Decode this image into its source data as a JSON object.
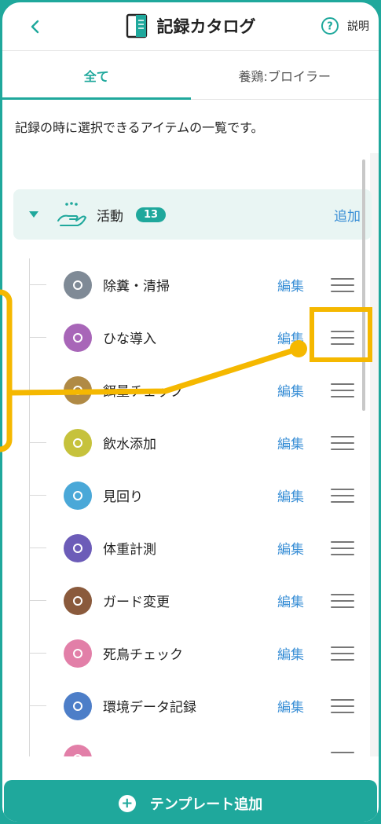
{
  "header": {
    "back_label": "<",
    "title": "記録カタログ",
    "help_label": "説明"
  },
  "tabs": [
    {
      "label": "全て",
      "active": true
    },
    {
      "label": "養鶏:ブロイラー",
      "active": false
    }
  ],
  "description": "記録の時に選択できるアイテムの一覧です。",
  "category": {
    "label": "活動",
    "count": "13",
    "add_label": "追加"
  },
  "items": [
    {
      "label": "除糞・清掃",
      "edit": "編集",
      "color": "#7f8a96",
      "icon": "broom-icon"
    },
    {
      "label": "ひな導入",
      "edit": "編集",
      "color": "#a866b8",
      "icon": "house-icon"
    },
    {
      "label": "餌量チェック",
      "edit": "編集",
      "color": "#b08a45",
      "icon": "feed-icon"
    },
    {
      "label": "飲水添加",
      "edit": "編集",
      "color": "#c6c23c",
      "icon": "water-icon"
    },
    {
      "label": "見回り",
      "edit": "編集",
      "color": "#4aa8d8",
      "icon": "magnifier-icon"
    },
    {
      "label": "体重計測",
      "edit": "編集",
      "color": "#6c5cb8",
      "icon": "scale-icon"
    },
    {
      "label": "ガード変更",
      "edit": "編集",
      "color": "#8a5a3c",
      "icon": "guard-icon"
    },
    {
      "label": "死鳥チェック",
      "edit": "編集",
      "color": "#e27fa8",
      "icon": "bird-icon"
    },
    {
      "label": "環境データ記録",
      "edit": "編集",
      "color": "#4d7ec8",
      "icon": "thermometer-icon"
    },
    {
      "label": "",
      "edit": "",
      "color": "#e27fa8",
      "icon": "partial-icon"
    }
  ],
  "bottom_button": {
    "label": "テンプレート追加"
  },
  "colors": {
    "accent": "#1fa89c",
    "link": "#3a8fd6",
    "annotation": "#f5b800"
  }
}
